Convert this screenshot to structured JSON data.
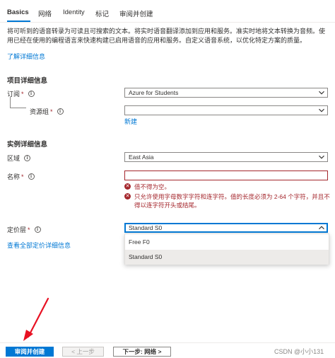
{
  "tabs": [
    "Basics",
    "网络",
    "Identity",
    "标记",
    "审阅并创建"
  ],
  "description": "将可听到的语音转录为可读且可搜索的文本。将实时语音翻译添加到应用和服务。准实时地将文本转换为音频。使用已经在使用的编程语言来快速构建已启用语音的应用和服务。自定义语音系统，以优化特定方案的质量。",
  "learn_more_link": "了解详细信息",
  "project_section": {
    "title": "项目详细信息",
    "subscription_label": "订阅",
    "subscription_value": "Azure for Students",
    "resource_group_label": "资源组",
    "resource_group_value": "",
    "create_new_link": "新建"
  },
  "instance_section": {
    "title": "实例详细信息",
    "region_label": "区域",
    "region_value": "East Asia",
    "name_label": "名称",
    "name_value": "",
    "errors": [
      "值不得为空。",
      "只允许使用字母数字字符和连字符。值的长度必须为 2-64 个字符，并且不得以连字符开头或结尾。"
    ],
    "pricing_label": "定价层",
    "pricing_value": "Standard S0",
    "pricing_options": [
      "Free F0",
      "Standard S0"
    ],
    "pricing_link": "查看全部定价详细信息"
  },
  "required_mark": "*",
  "info_glyph": "i",
  "footer": {
    "review_create": "审阅并创建",
    "previous": "< 上一步",
    "next": "下一步: 网络 >"
  },
  "watermark": "CSDN @小小131",
  "colors": {
    "accent": "#0078d4",
    "error": "#a4262c",
    "arrow": "#e81123"
  }
}
